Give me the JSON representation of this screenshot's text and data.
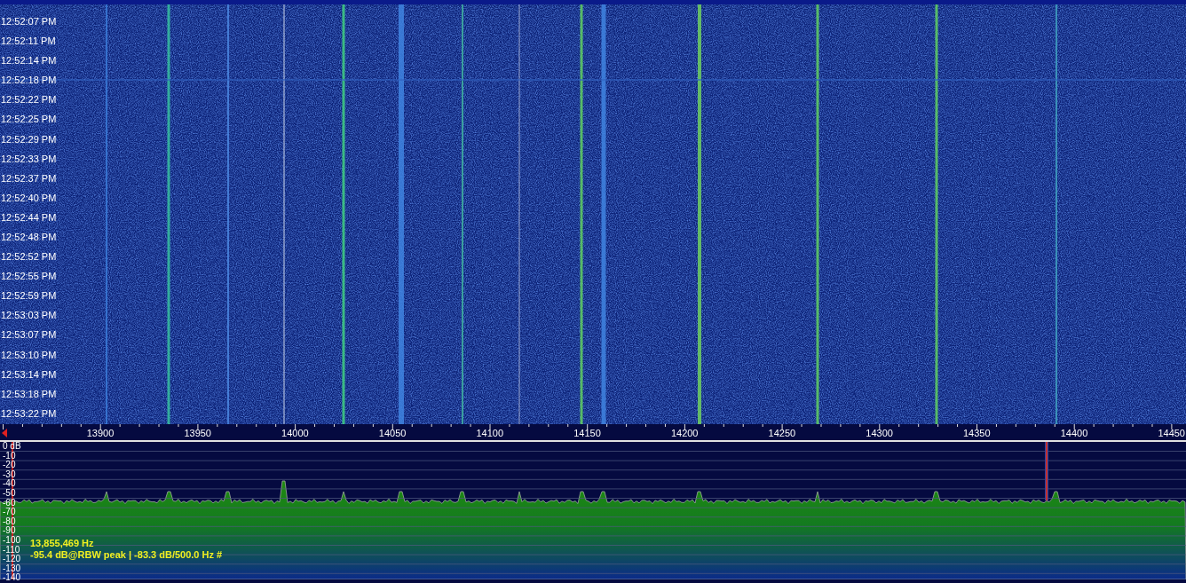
{
  "waterfall": {
    "times": [
      "12:52:07 PM",
      "12:52:11 PM",
      "12:52:14 PM",
      "12:52:18 PM",
      "12:52:22 PM",
      "12:52:25 PM",
      "12:52:29 PM",
      "12:52:33 PM",
      "12:52:37 PM",
      "12:52:40 PM",
      "12:52:44 PM",
      "12:52:48 PM",
      "12:52:52 PM",
      "12:52:55 PM",
      "12:52:59 PM",
      "12:53:03 PM",
      "12:53:07 PM",
      "12:53:10 PM",
      "12:53:14 PM",
      "12:53:18 PM",
      "12:53:22 PM"
    ]
  },
  "frequency_axis": {
    "labels": [
      "13900",
      "13950",
      "14000",
      "14050",
      "14100",
      "14150",
      "14200",
      "14250",
      "14300",
      "14350",
      "14400",
      "14450"
    ]
  },
  "spectrum": {
    "db_labels": [
      "0 dB",
      "-10",
      "-20",
      "-30",
      "-40",
      "-50",
      "-60",
      "-70",
      "-80",
      "-90",
      "-100",
      "-110",
      "-120",
      "-130",
      "-140"
    ],
    "readout": {
      "frequency": "13,855,469 Hz",
      "level": "-95.4 dB@RBW peak | -83.3 dB/500.0 Hz #"
    }
  }
}
